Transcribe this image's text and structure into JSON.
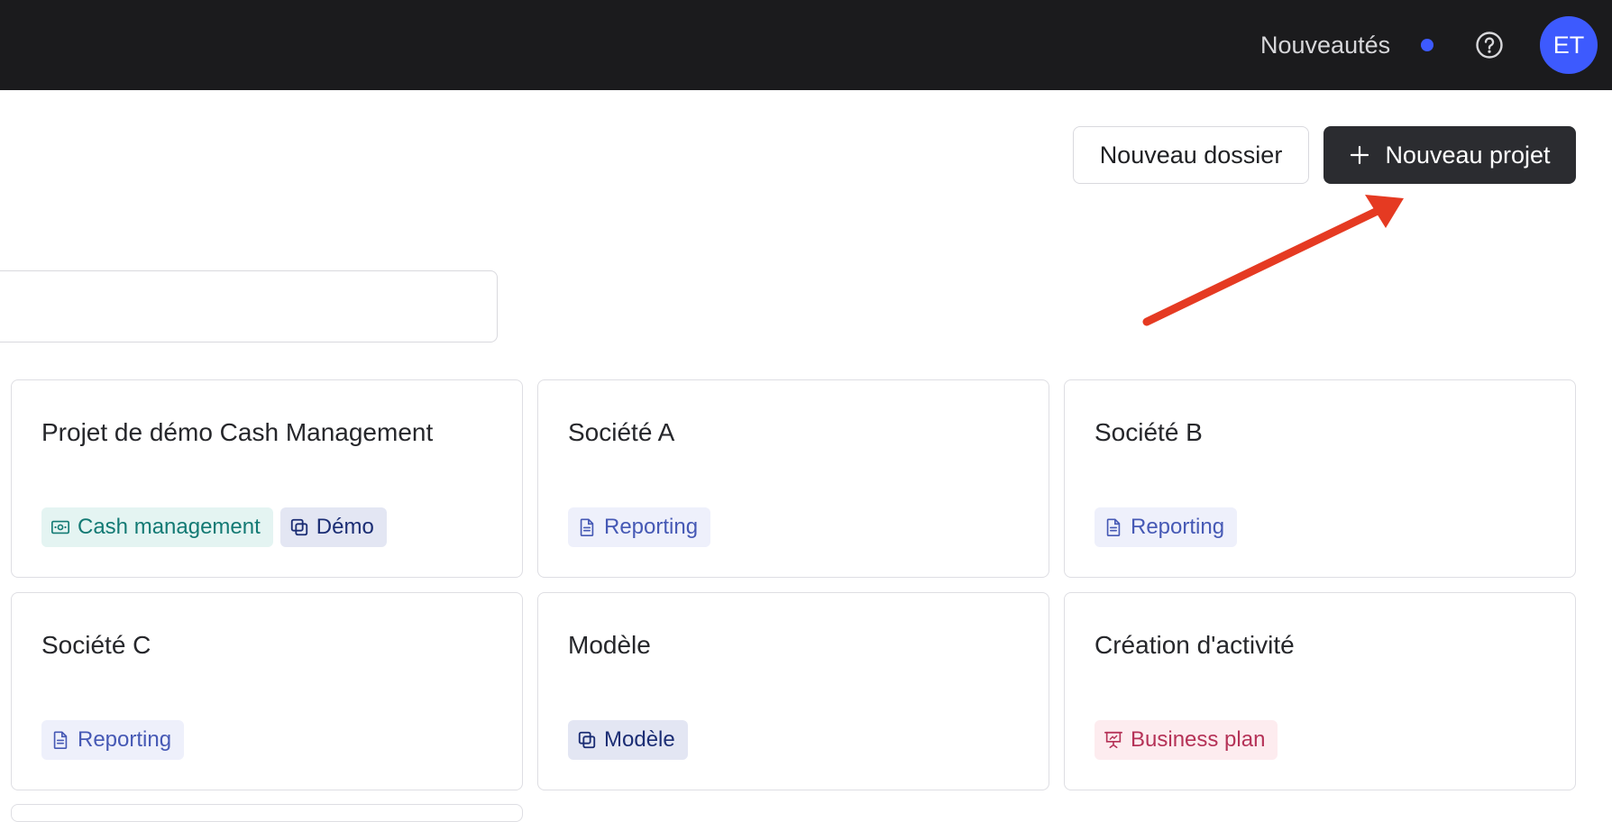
{
  "topbar": {
    "news_label": "Nouveautés",
    "news_dot_color": "#3d5afe",
    "help_icon": "help-circle-icon",
    "avatar_initials": "ET",
    "avatar_color": "#3d5afe"
  },
  "actions": {
    "new_folder_label": "Nouveau dossier",
    "new_project_label": "Nouveau projet",
    "new_project_icon": "plus-icon"
  },
  "search": {
    "value": "",
    "placeholder": ""
  },
  "annotation": {
    "arrow_color": "#e53a22",
    "points_to": "new-project-button"
  },
  "projects": [
    {
      "title": "Projet de démo Cash Management",
      "tags": [
        {
          "label": "Cash management",
          "icon": "banknote-icon",
          "style": "cash"
        },
        {
          "label": "Démo",
          "icon": "copy-icon",
          "style": "demo"
        }
      ]
    },
    {
      "title": "Société A",
      "tags": [
        {
          "label": "Reporting",
          "icon": "document-icon",
          "style": "report"
        }
      ]
    },
    {
      "title": "Société B",
      "tags": [
        {
          "label": "Reporting",
          "icon": "document-icon",
          "style": "report"
        }
      ]
    },
    {
      "title": "Société C",
      "tags": [
        {
          "label": "Reporting",
          "icon": "document-icon",
          "style": "report"
        }
      ]
    },
    {
      "title": "Modèle",
      "tags": [
        {
          "label": "Modèle",
          "icon": "copy-icon",
          "style": "demo"
        }
      ]
    },
    {
      "title": "Création d'activité",
      "tags": [
        {
          "label": "Business plan",
          "icon": "presentation-icon",
          "style": "bp"
        }
      ]
    }
  ]
}
